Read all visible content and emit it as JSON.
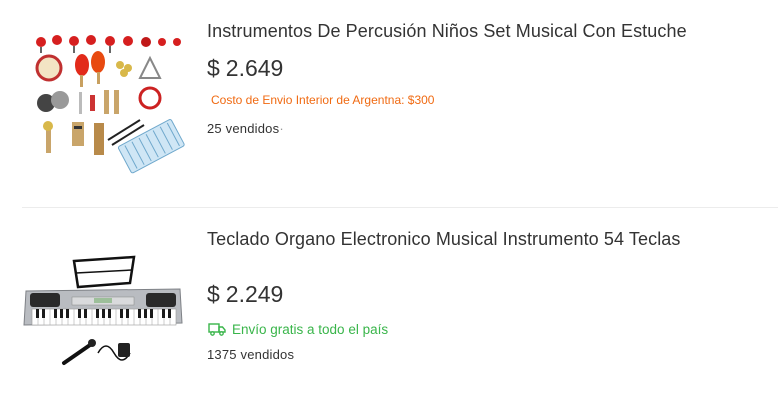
{
  "products": [
    {
      "title": "Instrumentos De Percusión Niños Set Musical Con Estuche",
      "currency": "$",
      "price": "2.649",
      "shipping_note": "Costo de Envio Interior de Argentna: $300",
      "sold": "25 vendidos",
      "sold_suffix": "·",
      "image_icon": "percussion-set-image"
    },
    {
      "title": "Teclado Organo Electronico Musical Instrumento 54 Teclas",
      "currency": "$",
      "price": "2.249",
      "shipping_note": "Envío gratis a todo el país",
      "shipping_icon": "truck-icon",
      "sold": "1375 vendidos",
      "image_icon": "keyboard-image"
    }
  ],
  "colors": {
    "shipping_cost": "#f06a12",
    "free_shipping": "#39b54a",
    "text": "#333333"
  }
}
